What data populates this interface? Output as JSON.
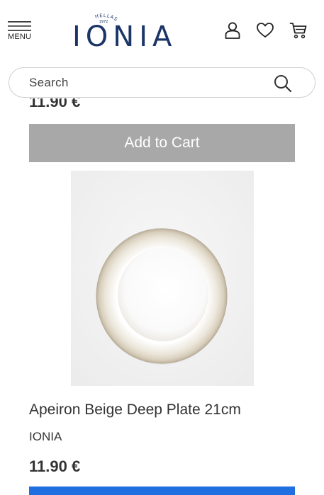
{
  "header": {
    "menu_label": "MENU",
    "logo_text": "IONIA",
    "logo_tagline": "HELLAS",
    "logo_year": "1972",
    "icons": [
      "menu-icon",
      "user-icon",
      "heart-icon",
      "cart-icon"
    ]
  },
  "search": {
    "placeholder": "Search",
    "icon": "search-icon"
  },
  "previous_product": {
    "price": "11.90 €",
    "add_to_cart_label": "Add to Cart"
  },
  "product": {
    "name": "Apeiron Beige Deep Plate 21cm",
    "brand": "IONIA",
    "price": "11.90 €"
  },
  "colors": {
    "brand": "#1c3567",
    "add_to_cart_bg": "#a8a8a8",
    "next_button_bg": "#1f6fe0"
  }
}
